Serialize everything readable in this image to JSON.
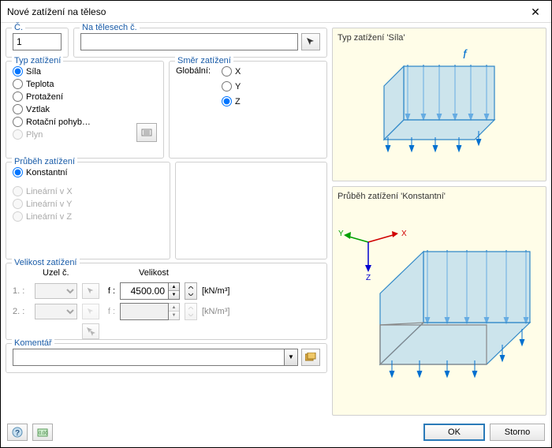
{
  "window": {
    "title": "Nové zatížení na těleso",
    "close": "✕"
  },
  "number": {
    "label": "Č.",
    "value": "1"
  },
  "on_solids": {
    "label": "Na tělesech č.",
    "value": ""
  },
  "load_type": {
    "label": "Typ zatížení",
    "items": [
      {
        "label": "Síla",
        "checked": true,
        "disabled": false
      },
      {
        "label": "Teplota",
        "checked": false,
        "disabled": false
      },
      {
        "label": "Protažení",
        "checked": false,
        "disabled": false
      },
      {
        "label": "Vztlak",
        "checked": false,
        "disabled": false
      },
      {
        "label": "Rotační pohyb…",
        "checked": false,
        "disabled": false
      },
      {
        "label": "Plyn",
        "checked": false,
        "disabled": true
      }
    ]
  },
  "direction": {
    "label": "Směr zatížení",
    "global": "Globální:",
    "items": [
      {
        "label": "X",
        "checked": false
      },
      {
        "label": "Y",
        "checked": false
      },
      {
        "label": "Z",
        "checked": true
      }
    ]
  },
  "distribution": {
    "label": "Průběh zatížení",
    "items": [
      {
        "label": "Konstantní",
        "checked": true,
        "disabled": false
      },
      {
        "label": "Lineární v X",
        "checked": false,
        "disabled": true
      },
      {
        "label": "Lineární v Y",
        "checked": false,
        "disabled": true
      },
      {
        "label": "Lineární v Z",
        "checked": false,
        "disabled": true
      }
    ]
  },
  "magnitude": {
    "label": "Velikost zatížení",
    "h_node": "Uzel č.",
    "h_val": "Velikost",
    "rows": [
      {
        "lab": "1. :",
        "f": "f :",
        "val": "4500.00",
        "unit": "[kN/m³]",
        "disabled": false
      },
      {
        "lab": "2. :",
        "f": "f :",
        "val": "",
        "unit": "[kN/m³]",
        "disabled": true
      }
    ]
  },
  "comment": {
    "label": "Komentář",
    "value": ""
  },
  "preview1": {
    "title": "Typ zatížení 'Síla'",
    "sym": "f"
  },
  "preview2": {
    "title": "Průběh zatížení 'Konstantní'",
    "ax": {
      "x": "X",
      "y": "Y",
      "z": "Z"
    }
  },
  "footer": {
    "ok": "OK",
    "cancel": "Storno"
  }
}
